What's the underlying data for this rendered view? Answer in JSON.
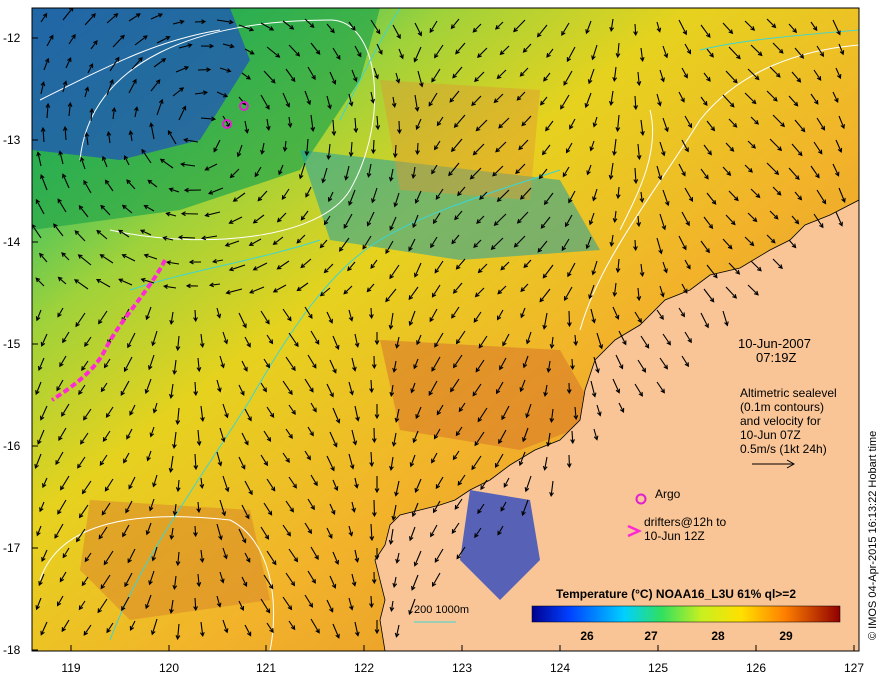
{
  "map": {
    "date": "10-Jun-2007",
    "time": "07:19Z",
    "altimetry_lines": [
      "Altimetric sealevel",
      "(0.1m contours)",
      "and velocity for",
      "10-Jun 07Z",
      "0.5m/s (1kt 24h)"
    ],
    "argo_label": "Argo",
    "drifters_lines": [
      "drifters@12h to",
      "10-Jun 12Z"
    ],
    "depth_legend": "200  1000m",
    "colorbar_title": "Temperature (°C) NOAA16_L3U 61% ql>=2",
    "colorbar_ticks": [
      "26",
      "27",
      "28",
      "29"
    ],
    "credit": "© IMOS 04-Apr-2015 16:13:22 Hobart time",
    "lat_labels": [
      "-12",
      "-13",
      "-14",
      "-15",
      "-16",
      "-17",
      "-18"
    ],
    "lon_labels": [
      "119",
      "120",
      "121",
      "122",
      "123",
      "124",
      "125",
      "126",
      "127"
    ],
    "colors": {
      "land": "#f9c596",
      "depth_contour": "#3ad6d6",
      "sealevel_contour": "#ffffff",
      "drifter": "#ff2ad4",
      "argo": "#e020d0"
    }
  }
}
